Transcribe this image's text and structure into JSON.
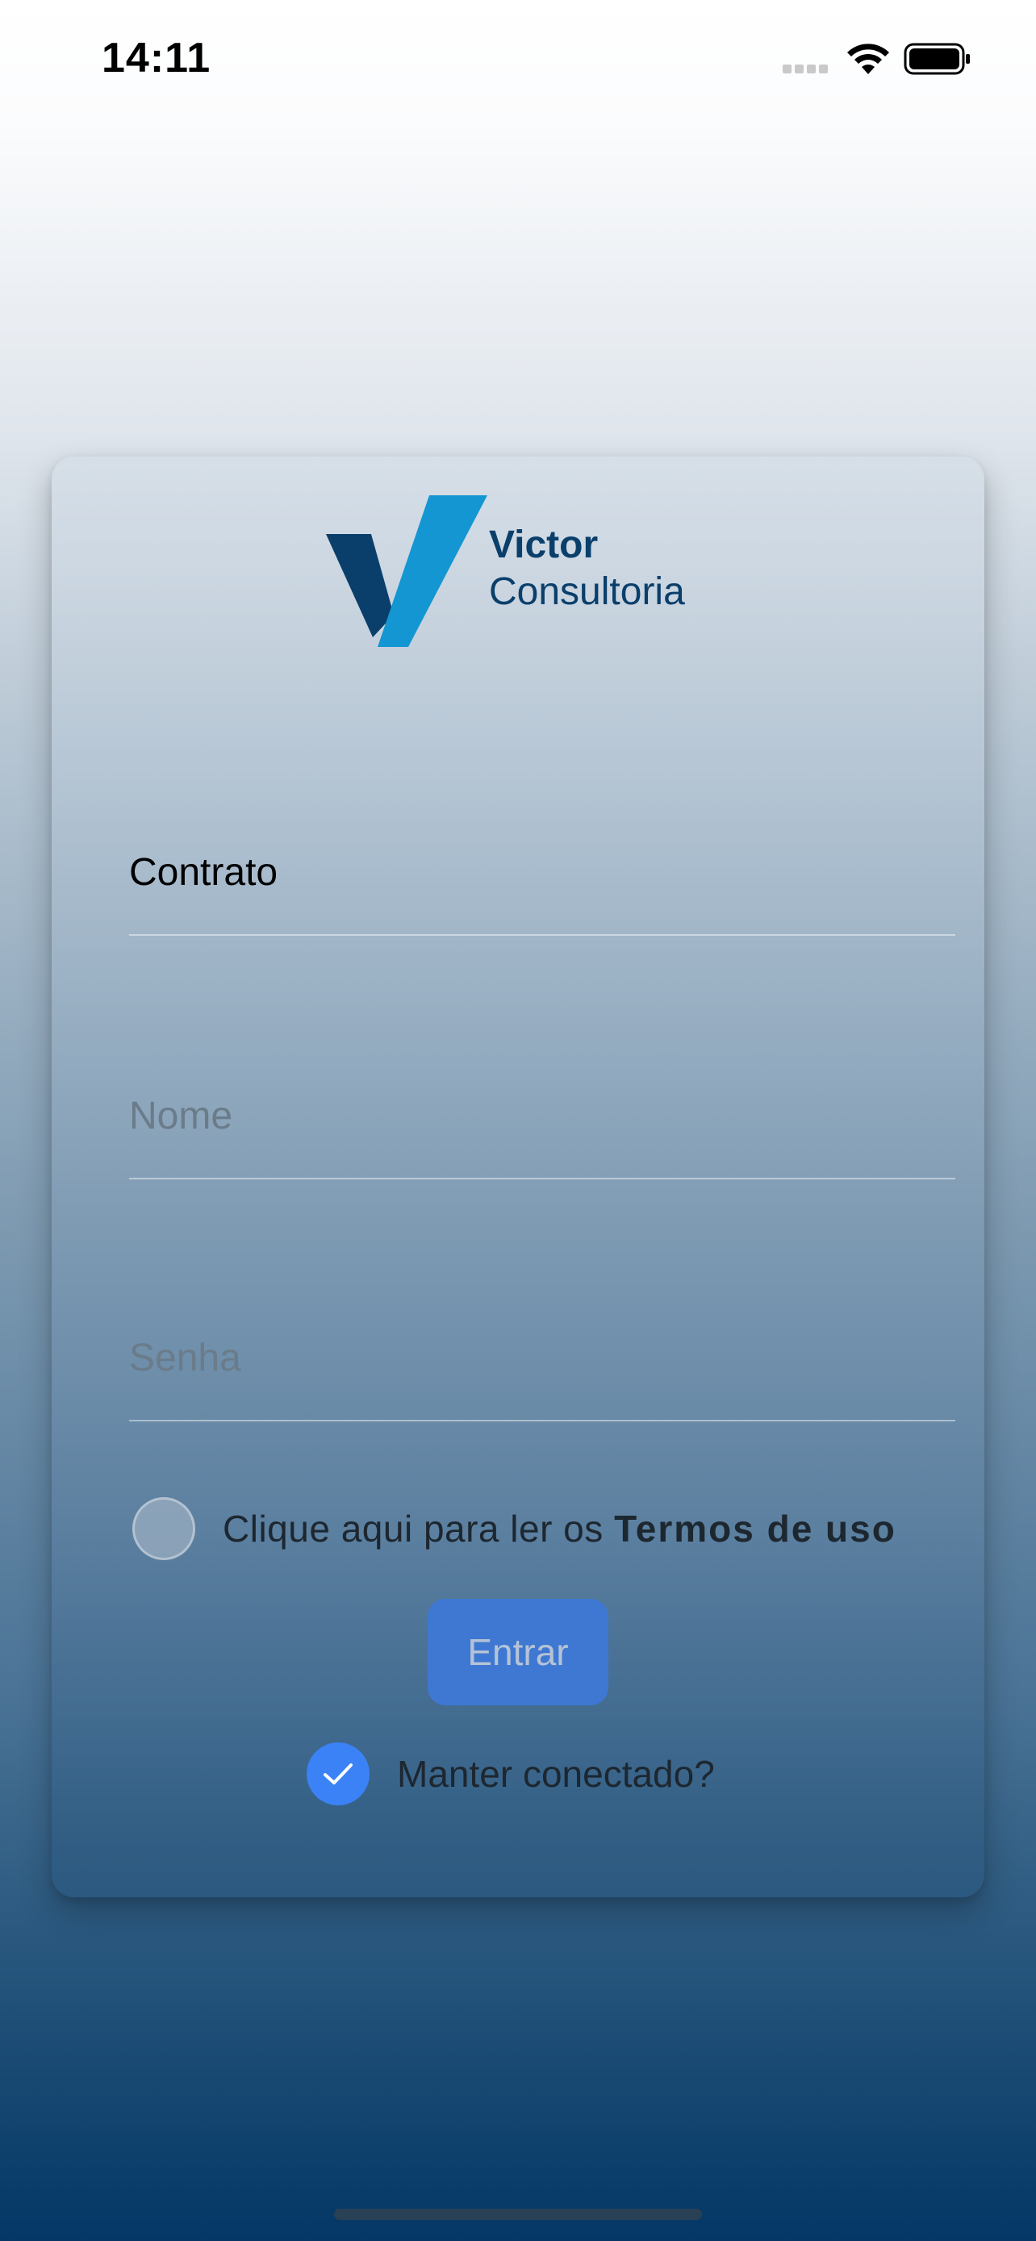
{
  "status_bar": {
    "time": "14:11"
  },
  "logo": {
    "line1": "Victor",
    "line2": "Consultoria"
  },
  "form": {
    "contract_label": "Contrato",
    "name_placeholder": "Nome",
    "password_placeholder": "Senha",
    "terms_prefix": "Clique aqui para ler os",
    "terms_link": "Termos de uso",
    "submit_label": "Entrar",
    "keep_connected_label": "Manter conectado?",
    "keep_connected_checked": true,
    "terms_accepted": false
  },
  "colors": {
    "brand_dark": "#0a3f6b",
    "brand_light": "#1396d2",
    "accent": "#3b82f6",
    "button": "#3e78d2"
  }
}
